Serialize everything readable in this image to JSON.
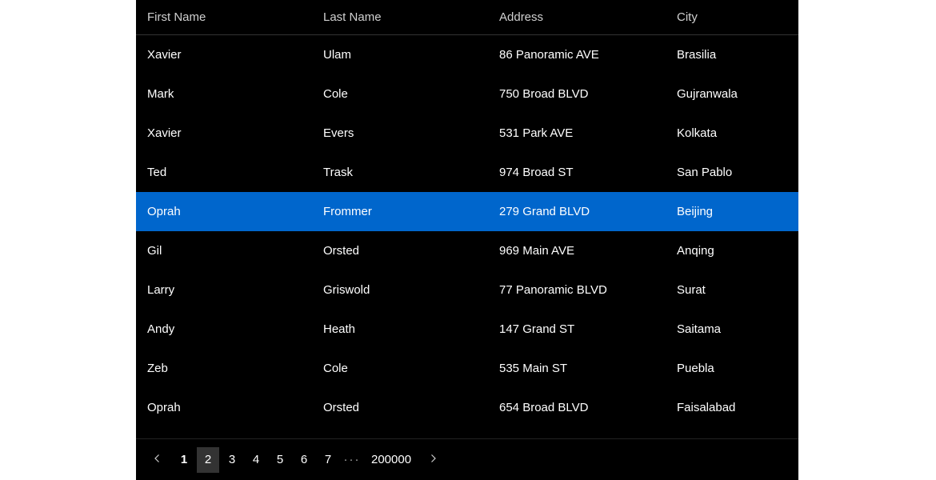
{
  "table": {
    "columns": [
      "First Name",
      "Last Name",
      "Address",
      "City"
    ],
    "rows": [
      {
        "first": "Xavier",
        "last": "Ulam",
        "addr": "86 Panoramic AVE",
        "city": "Brasilia",
        "selected": false
      },
      {
        "first": "Mark",
        "last": "Cole",
        "addr": "750 Broad BLVD",
        "city": "Gujranwala",
        "selected": false
      },
      {
        "first": "Xavier",
        "last": "Evers",
        "addr": "531 Park AVE",
        "city": "Kolkata",
        "selected": false
      },
      {
        "first": "Ted",
        "last": "Trask",
        "addr": "974 Broad ST",
        "city": "San Pablo",
        "selected": false
      },
      {
        "first": "Oprah",
        "last": "Frommer",
        "addr": "279 Grand BLVD",
        "city": "Beijing",
        "selected": true
      },
      {
        "first": "Gil",
        "last": "Orsted",
        "addr": "969 Main AVE",
        "city": "Anqing",
        "selected": false
      },
      {
        "first": "Larry",
        "last": "Griswold",
        "addr": "77 Panoramic BLVD",
        "city": "Surat",
        "selected": false
      },
      {
        "first": "Andy",
        "last": "Heath",
        "addr": "147 Grand ST",
        "city": "Saitama",
        "selected": false
      },
      {
        "first": "Zeb",
        "last": "Cole",
        "addr": "535 Main ST",
        "city": "Puebla",
        "selected": false
      },
      {
        "first": "Oprah",
        "last": "Orsted",
        "addr": "654 Broad BLVD",
        "city": "Faisalabad",
        "selected": false
      }
    ]
  },
  "pager": {
    "pages": [
      "1",
      "2",
      "3",
      "4",
      "5",
      "6",
      "7"
    ],
    "ellipsis": "···",
    "last_page": "200000",
    "current": "1",
    "highlighted": "2"
  },
  "colors": {
    "selection": "#0066cc",
    "background": "#000000",
    "foreground": "#ffffff"
  }
}
